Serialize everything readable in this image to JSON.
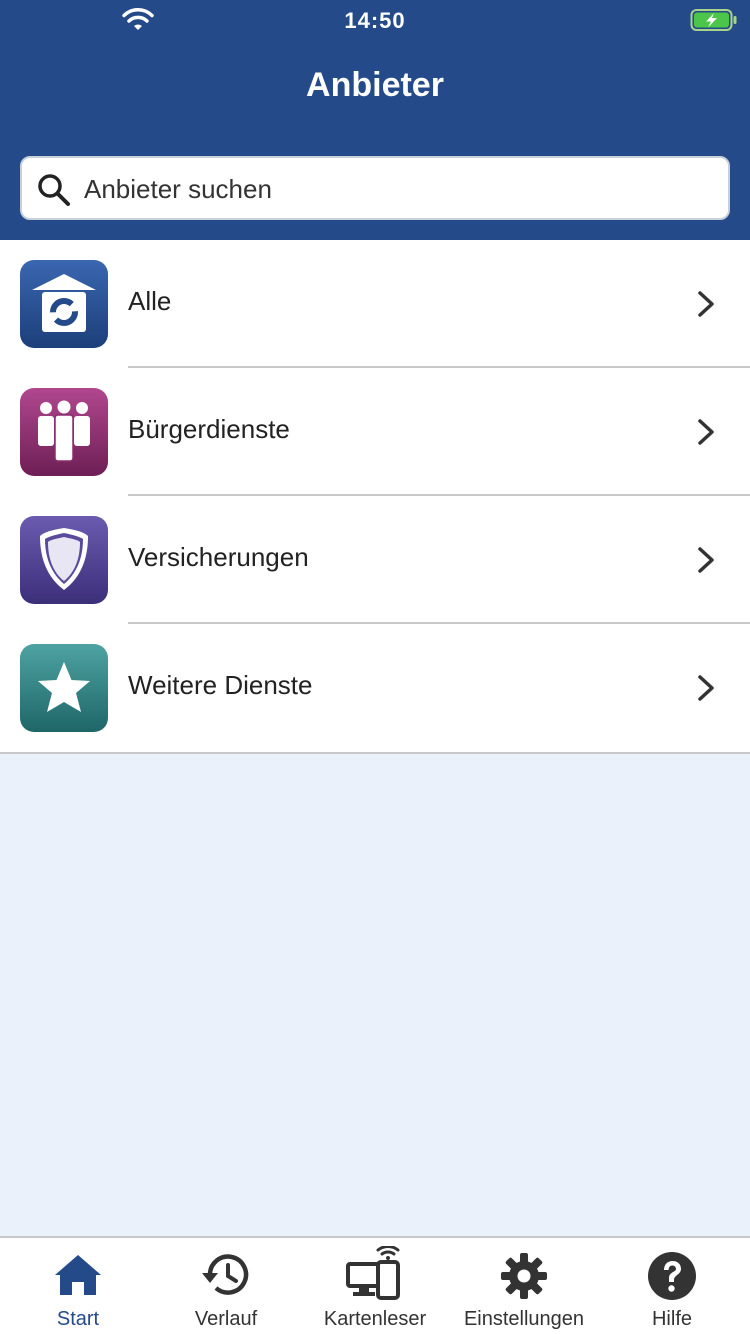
{
  "status_bar": {
    "time": "14:50"
  },
  "header": {
    "title": "Anbieter"
  },
  "search": {
    "placeholder": "Anbieter suchen"
  },
  "list": {
    "items": [
      {
        "label": "Alle",
        "icon": "house-logo-icon",
        "color": "#244a89"
      },
      {
        "label": "Bürgerdienste",
        "icon": "people-icon",
        "color": "#8a2c6e"
      },
      {
        "label": "Versicherungen",
        "icon": "shield-icon",
        "color": "#4e3f8f"
      },
      {
        "label": "Weitere Dienste",
        "icon": "star-icon",
        "color": "#2d7d7e"
      }
    ]
  },
  "tabbar": {
    "tabs": [
      {
        "label": "Start",
        "icon": "home-icon",
        "active": true
      },
      {
        "label": "Verlauf",
        "icon": "history-icon",
        "active": false
      },
      {
        "label": "Kartenleser",
        "icon": "card-reader-icon",
        "active": false
      },
      {
        "label": "Einstellungen",
        "icon": "gear-icon",
        "active": false
      },
      {
        "label": "Hilfe",
        "icon": "help-icon",
        "active": false
      }
    ]
  },
  "colors": {
    "primary": "#244a89",
    "background": "#eaf1fb"
  }
}
